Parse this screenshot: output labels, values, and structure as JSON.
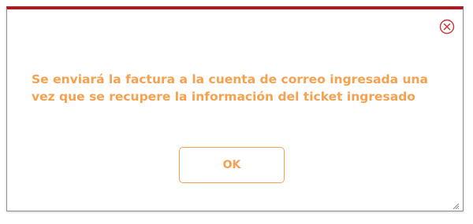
{
  "dialog": {
    "message": "Se enviará la factura a la cuenta de correo ingresada una vez que se recupere la información del ticket ingresado",
    "ok_label": "OK",
    "close_icon": "close-circle-icon",
    "resize_icon": "resize-grip-icon"
  },
  "colors": {
    "accent": "#f5a14f",
    "top_border": "#a81d23",
    "close_icon": "#c8343a"
  }
}
